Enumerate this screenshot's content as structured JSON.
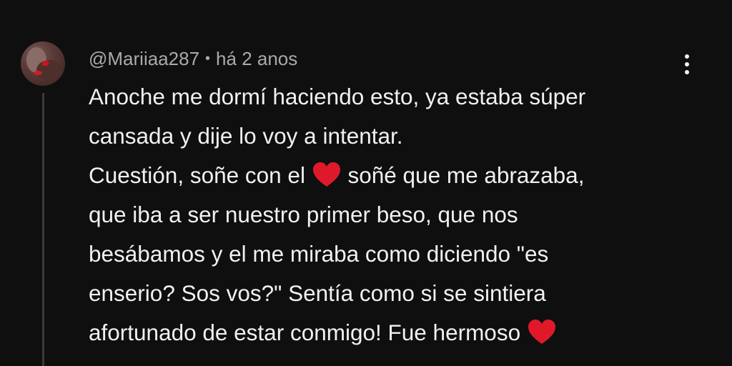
{
  "comment": {
    "author": "@Mariiaa287",
    "separator": "•",
    "time": "há 2 anos",
    "lines": [
      [
        "Anoche me dormí haciendo esto, ya estaba súper"
      ],
      [
        "cansada y dije lo voy a intentar."
      ],
      [
        "Cuestión, soñe con el ",
        "soñé que me abrazaba,"
      ],
      [
        "que iba a ser nuestro primer beso, que nos"
      ],
      [
        "besábamos y el me miraba como diciendo \"es"
      ],
      [
        "enserio? Sos vos?\" Sentía como si se sintiera"
      ],
      [
        "afortunado de estar conmigo! Fue hermoso "
      ]
    ],
    "emoji": "heart-emoji",
    "heart_color": "#e0192a"
  },
  "icons": {
    "menu": "more-vert-icon"
  }
}
